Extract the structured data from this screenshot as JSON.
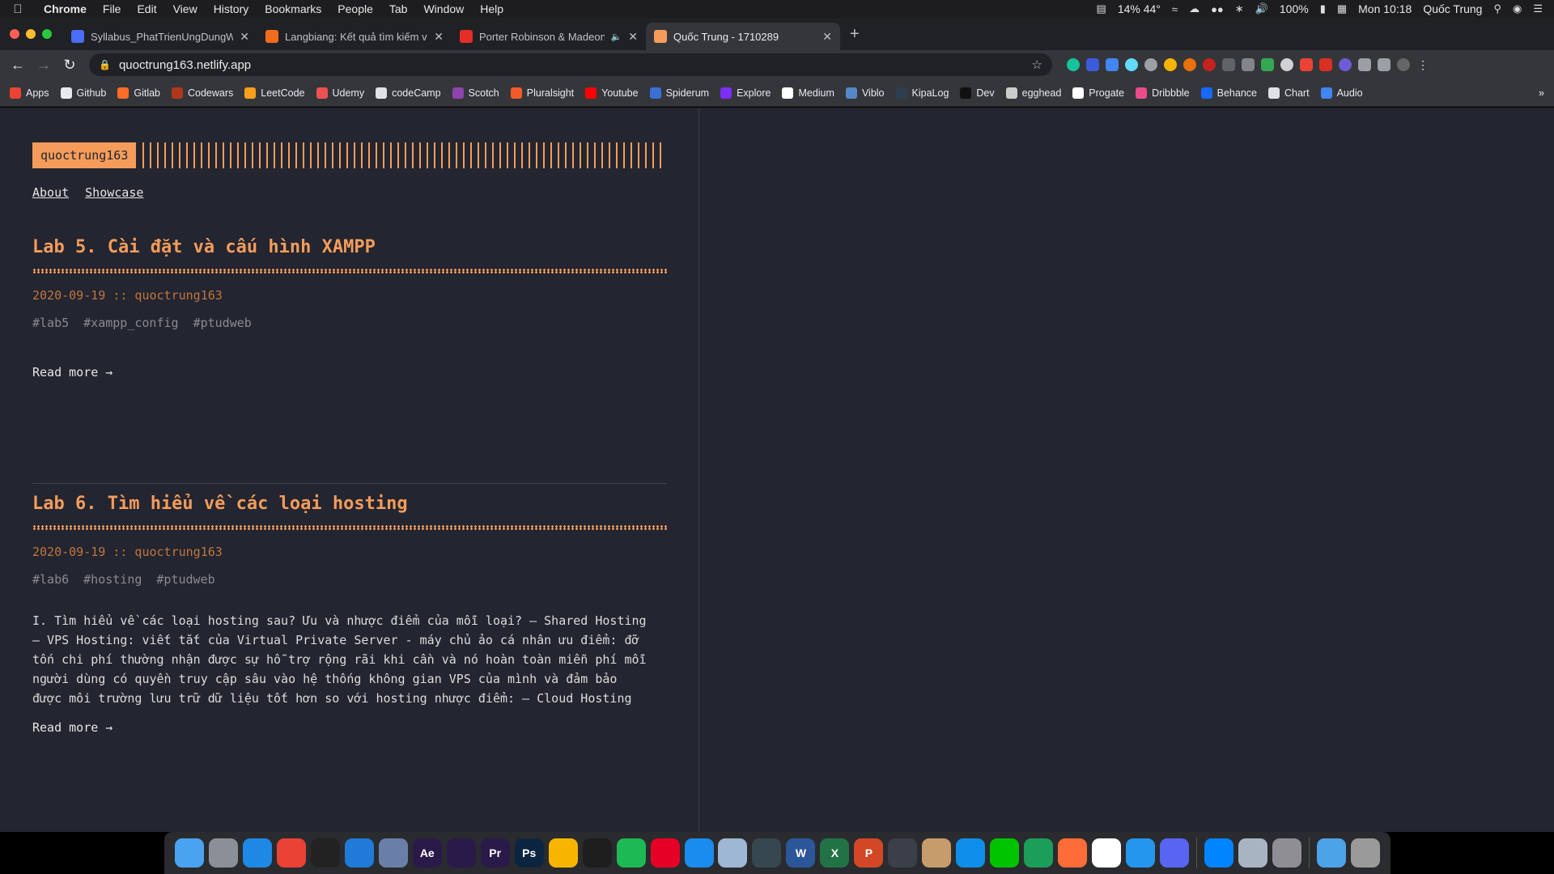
{
  "menubar": {
    "app": "Chrome",
    "items": [
      "File",
      "Edit",
      "View",
      "History",
      "Bookmarks",
      "People",
      "Tab",
      "Window",
      "Help"
    ],
    "status": {
      "cpu": "14% 44°",
      "battery": "100%",
      "clock": "Mon 10:18",
      "user": "Quốc Trung"
    }
  },
  "tabs": [
    {
      "title": "Syllabus_PhatTrienUngDungWe",
      "color": "#4a6cf7",
      "active": false
    },
    {
      "title": "Langbiang: Kết quả tìm kiếm về",
      "color": "#f26b1d",
      "active": false
    },
    {
      "title": "Porter Robinson & Madeon",
      "color": "#e52d27",
      "active": false
    },
    {
      "title": "Quốc Trung - 1710289",
      "color": "#f59c5a",
      "active": true
    }
  ],
  "address": {
    "url": "quoctrung163.netlify.app"
  },
  "bookmarks": [
    {
      "label": "Apps",
      "color": "#ea4335"
    },
    {
      "label": "Github",
      "color": "#e8eaed"
    },
    {
      "label": "Gitlab",
      "color": "#fc6d26"
    },
    {
      "label": "Codewars",
      "color": "#b1361e"
    },
    {
      "label": "LeetCode",
      "color": "#f89f1b"
    },
    {
      "label": "Udemy",
      "color": "#ec5252"
    },
    {
      "label": "codeCamp",
      "color": "#dfe1e5"
    },
    {
      "label": "Scotch",
      "color": "#8e44ad"
    },
    {
      "label": "Pluralsight",
      "color": "#f15b2a"
    },
    {
      "label": "Youtube",
      "color": "#ff0000"
    },
    {
      "label": "Spiderum",
      "color": "#3a6fd8"
    },
    {
      "label": "Explore",
      "color": "#7b2ff7"
    },
    {
      "label": "Medium",
      "color": "#ffffff"
    },
    {
      "label": "Viblo",
      "color": "#5488c7"
    },
    {
      "label": "KipaLog",
      "color": "#2c3e50"
    },
    {
      "label": "Dev",
      "color": "#111111"
    },
    {
      "label": "egghead",
      "color": "#cccccc"
    },
    {
      "label": "Progate",
      "color": "#ffffff"
    },
    {
      "label": "Dribbble",
      "color": "#ea4c89"
    },
    {
      "label": "Behance",
      "color": "#1769ff"
    },
    {
      "label": "Chart",
      "color": "#dfe1e5"
    },
    {
      "label": "Audio",
      "color": "#4285f4"
    }
  ],
  "site": {
    "logo": "quoctrung163",
    "nav": [
      "About",
      "Showcase"
    ],
    "accent": "#f59c5a",
    "background": "#232530"
  },
  "posts": [
    {
      "title": "Lab 5. Cài đặt và cấu hình XAMPP",
      "meta": "2020-09-19 :: quoctrung163",
      "tags": [
        "#lab5",
        "#xampp_config",
        "#ptudweb"
      ],
      "excerpt": "",
      "read_more": "Read more →"
    },
    {
      "title": "Lab 6. Tìm hiểu về các loại hosting",
      "meta": "2020-09-19 :: quoctrung163",
      "tags": [
        "#lab6",
        "#hosting",
        "#ptudweb"
      ],
      "excerpt_lines": [
        "I. Tìm hiểu về các loại hosting sau? Ưu và nhược điểm của mỗi loại? — Shared Hosting",
        "— VPS Hosting: viết tắt của Virtual Private Server - máy chủ ảo cá nhân ưu điểm: đỡ",
        "tốn chi phí thường nhận được sự hỗ trợ rộng rãi khi cần và nó hoàn toàn miễn phí mỗi",
        "người dùng có quyền truy cập sâu vào hệ thống không gian VPS của mình và đảm bảo",
        "được môi trường lưu trữ dữ liệu tốt hơn so với hosting nhược điểm: — Cloud Hosting"
      ],
      "read_more": "Read more →"
    }
  ],
  "dock": [
    {
      "name": "finder",
      "color": "#4aa3f0",
      "glyph": ""
    },
    {
      "name": "launchpad",
      "color": "#8a8f98",
      "glyph": ""
    },
    {
      "name": "safari",
      "color": "#1e88e5",
      "glyph": ""
    },
    {
      "name": "chrome",
      "color": "#e94235",
      "glyph": ""
    },
    {
      "name": "terminal",
      "color": "#222",
      "glyph": ""
    },
    {
      "name": "vscode",
      "color": "#1f7ad8",
      "glyph": ""
    },
    {
      "name": "xcode-tool",
      "color": "#6a7fa8",
      "glyph": ""
    },
    {
      "name": "after-effects",
      "color": "#2a1a4a",
      "glyph": "Ae"
    },
    {
      "name": "premiere-proj",
      "color": "#2a1a4a",
      "glyph": ""
    },
    {
      "name": "premiere-pro",
      "color": "#2a1a4a",
      "glyph": "Pr"
    },
    {
      "name": "photoshop",
      "color": "#0b2540",
      "glyph": "Ps"
    },
    {
      "name": "sketch",
      "color": "#f7b500",
      "glyph": ""
    },
    {
      "name": "figma",
      "color": "#1e1e1e",
      "glyph": ""
    },
    {
      "name": "spotify",
      "color": "#1db954",
      "glyph": ""
    },
    {
      "name": "netease-music",
      "color": "#e60026",
      "glyph": ""
    },
    {
      "name": "app-store",
      "color": "#1a8cf0",
      "glyph": ""
    },
    {
      "name": "preview",
      "color": "#9db7d4",
      "glyph": ""
    },
    {
      "name": "mail",
      "color": "#37474f",
      "glyph": ""
    },
    {
      "name": "word",
      "color": "#2b579a",
      "glyph": "W"
    },
    {
      "name": "excel",
      "color": "#217346",
      "glyph": "X"
    },
    {
      "name": "powerpoint",
      "color": "#d24726",
      "glyph": "P"
    },
    {
      "name": "proxyman",
      "color": "#3b3f4a",
      "glyph": ""
    },
    {
      "name": "archive-utility",
      "color": "#c69c6d",
      "glyph": ""
    },
    {
      "name": "teamviewer",
      "color": "#0e8ee9",
      "glyph": ""
    },
    {
      "name": "line",
      "color": "#00c300",
      "glyph": ""
    },
    {
      "name": "sourcetree",
      "color": "#1b9e5a",
      "glyph": ""
    },
    {
      "name": "postman",
      "color": "#ff6c37",
      "glyph": ""
    },
    {
      "name": "slack",
      "color": "#ffffff",
      "glyph": ""
    },
    {
      "name": "docker",
      "color": "#2496ed",
      "glyph": ""
    },
    {
      "name": "discord",
      "color": "#5865f2",
      "glyph": ""
    },
    {
      "name": "messenger",
      "color": "#0084ff",
      "glyph": ""
    },
    {
      "name": "system-info",
      "color": "#a9b4c2",
      "glyph": ""
    },
    {
      "name": "system-preferences",
      "color": "#8e8e93",
      "glyph": ""
    },
    {
      "name": "downloads-folder",
      "color": "#4da3e8",
      "glyph": ""
    },
    {
      "name": "trash",
      "color": "#9a9a9a",
      "glyph": ""
    }
  ]
}
